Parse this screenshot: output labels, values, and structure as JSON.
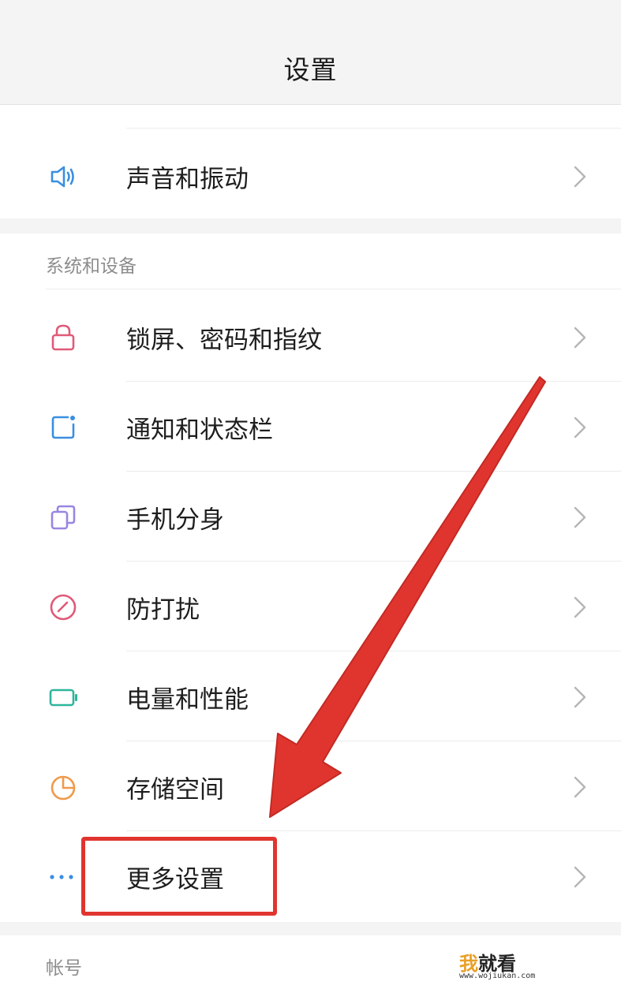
{
  "header": {
    "title": "设置"
  },
  "top_items": [
    {
      "label": "声音和振动",
      "icon": "speaker-icon",
      "color": "#3a8fe0"
    }
  ],
  "system_section": {
    "title": "系统和设备",
    "items": [
      {
        "label": "锁屏、密码和指纹",
        "icon": "lock-icon",
        "color": "#e05a78"
      },
      {
        "label": "通知和状态栏",
        "icon": "notification-icon",
        "color": "#3a8fe0"
      },
      {
        "label": "手机分身",
        "icon": "dual-phone-icon",
        "color": "#9a86e0"
      },
      {
        "label": "防打扰",
        "icon": "do-not-disturb-icon",
        "color": "#e05a78"
      },
      {
        "label": "电量和性能",
        "icon": "battery-icon",
        "color": "#2fb59c"
      },
      {
        "label": "存储空间",
        "icon": "storage-pie-icon",
        "color": "#ef9a4a"
      },
      {
        "label": "更多设置",
        "icon": "more-dots-icon",
        "color": "#3a8fe0"
      }
    ]
  },
  "account_section": {
    "title": "帐号"
  },
  "watermark": {
    "brand_red": "我",
    "brand_black": "就看",
    "url": "www.wojiukan.com"
  },
  "colors": {
    "annotation_red": "#e0352e",
    "chevron": "#b5b5b5"
  }
}
